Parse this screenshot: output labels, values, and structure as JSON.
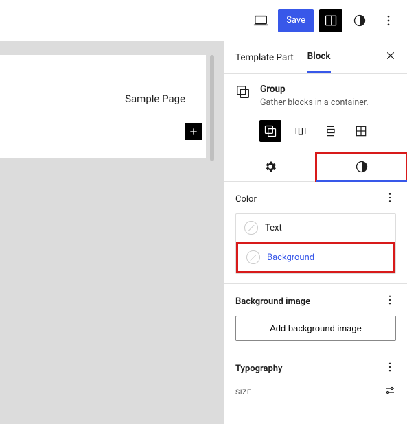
{
  "topbar": {
    "save_label": "Save"
  },
  "canvas": {
    "page_title": "Sample Page"
  },
  "sidebar": {
    "tabs": {
      "template_part": "Template Part",
      "block": "Block"
    },
    "block": {
      "name": "Group",
      "description": "Gather blocks in a container."
    },
    "panels": {
      "color": {
        "title": "Color",
        "text_label": "Text",
        "background_label": "Background"
      },
      "bg_image": {
        "title": "Background image",
        "add_button": "Add background image"
      },
      "typography": {
        "title": "Typography",
        "size_label": "SIZE"
      }
    }
  }
}
